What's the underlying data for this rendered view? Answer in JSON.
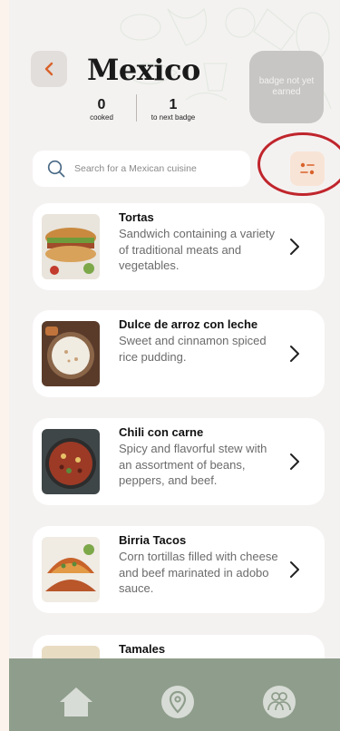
{
  "header": {
    "title": "Mexico",
    "stats": {
      "cooked_value": "0",
      "cooked_label": "cooked",
      "next_value": "1",
      "next_label": "to next badge"
    },
    "badge_text": "badge not yet earned"
  },
  "search": {
    "placeholder": "Search for a Mexican cuisine",
    "value": ""
  },
  "dishes": [
    {
      "name": "Tortas",
      "description": "Sandwich containing a variety of traditional meats and vegetables."
    },
    {
      "name": "Dulce de arroz con leche",
      "description": "Sweet and cinnamon spiced rice pudding."
    },
    {
      "name": "Chili con carne",
      "description": "Spicy and flavorful stew with an assortment of beans, peppers, and beef."
    },
    {
      "name": "Birria Tacos",
      "description": "Corn tortillas filled with cheese and beef marinated in adobo sauce."
    },
    {
      "name": "Tamales",
      "description": ""
    }
  ],
  "nav": {
    "items": [
      "home-icon",
      "location-pin-icon",
      "community-icon"
    ]
  },
  "colors": {
    "accent": "#d9622b",
    "nav_bg": "#8f9e8c",
    "highlight_circle": "#c0252c",
    "filter_bg": "#f8e4d6"
  }
}
